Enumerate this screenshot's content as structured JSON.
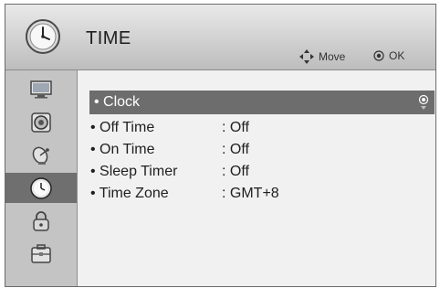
{
  "header": {
    "title": "TIME",
    "hint_move": "Move",
    "hint_ok": "OK"
  },
  "sidebar": {
    "items": [
      {
        "icon": "picture-icon",
        "active": false
      },
      {
        "icon": "audio-icon",
        "active": false
      },
      {
        "icon": "channel-icon",
        "active": false
      },
      {
        "icon": "clock-icon",
        "active": true
      },
      {
        "icon": "lock-icon",
        "active": false
      },
      {
        "icon": "option-icon",
        "active": false
      }
    ]
  },
  "menu": {
    "items": [
      {
        "label": "• Clock",
        "value": ""
      },
      {
        "label": "• Off Time",
        "value": ": Off"
      },
      {
        "label": "• On Time",
        "value": ": Off"
      },
      {
        "label": "• Sleep Timer",
        "value": ": Off"
      },
      {
        "label": "• Time Zone",
        "value": ": GMT+8"
      }
    ]
  },
  "colors": {
    "selected_row": "#6d6d6d",
    "sidebar_bg": "#c4c4c4",
    "sidebar_active": "#6f6f6f"
  }
}
